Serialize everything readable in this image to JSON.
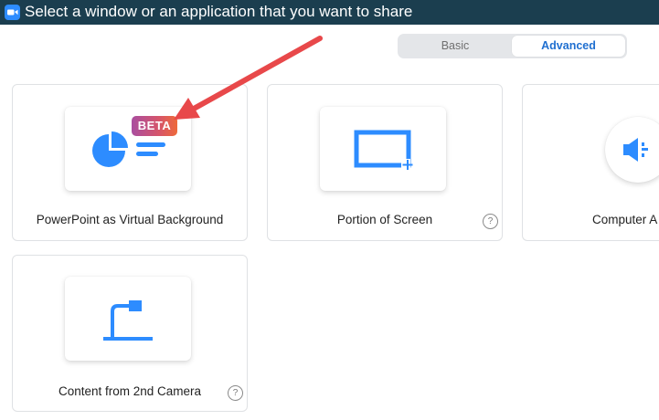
{
  "window": {
    "title": "Select a window or an application that you want to share"
  },
  "tabs": {
    "basic": "Basic",
    "advanced": "Advanced",
    "selected": "Advanced"
  },
  "options": [
    {
      "label": "PowerPoint as Virtual Background",
      "badge": "BETA",
      "icon": "powerpoint-icon"
    },
    {
      "label": "Portion of Screen",
      "help": "?",
      "icon": "portion-of-screen-icon"
    },
    {
      "label": "Computer A",
      "icon": "computer-audio-icon"
    },
    {
      "label": "Content from 2nd Camera",
      "help": "?",
      "icon": "document-camera-icon"
    }
  ],
  "colors": {
    "titlebar": "#1b3e4f",
    "accent_blue": "#2d8cff",
    "selected_tab_text": "#1f6fd0",
    "annotation_arrow": "#e8484a"
  }
}
